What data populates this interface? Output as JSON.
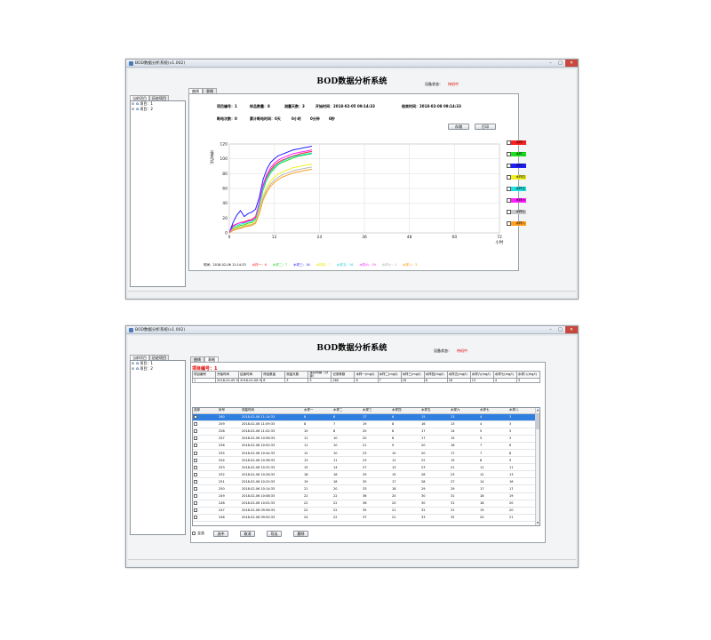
{
  "window_title": "BOD数据分析系统(v1.002)",
  "system_name": "BOD数据分析系统",
  "device_status_label": "设备状态：",
  "device_status_value": "待机中",
  "left_tabs": [
    "当前项目",
    "历史项目"
  ],
  "tree_items": [
    "项目：1",
    "项目：2"
  ],
  "main_tabs": [
    "曲线",
    "表格"
  ],
  "chart_info": {
    "project_no": "项目编号：1",
    "sample_count": "样品数量：8",
    "test_days": "测量天数：3",
    "start_time": "开始时间：2018-02-05 09:14:33",
    "end_time": "结束时间：2018-02-08 09:14:33",
    "power_off_count": "断电次数：0",
    "power_off_total": "累计断电时间：0天",
    "power_off_hours": "0小时",
    "power_off_minutes": "0分钟",
    "power_off_seconds": "0秒"
  },
  "buttons": {
    "save": "存储",
    "print": "打印"
  },
  "legend": [
    {
      "label": "水样一",
      "color": "#ff2020"
    },
    {
      "label": "水样二",
      "color": "#20e020"
    },
    {
      "label": "水样三",
      "color": "#2020ff"
    },
    {
      "label": "水样四",
      "color": "#f0f020"
    },
    {
      "label": "水样五",
      "color": "#20e0e0"
    },
    {
      "label": "水样六",
      "color": "#ff20ff"
    },
    {
      "label": "水样七",
      "color": "#c8c8c8"
    },
    {
      "label": "水样八",
      "color": "#ffa020"
    }
  ],
  "chart_footer": [
    {
      "text": "时间：2018-02-06 11:14:33",
      "color": "#000000"
    },
    {
      "text": "水样一：6",
      "color": "#ff2020"
    },
    {
      "text": "水样二：7",
      "color": "#20d020"
    },
    {
      "text": "水样三：16",
      "color": "#2020ff"
    },
    {
      "text": "水样四：7",
      "color": "#e8e800"
    },
    {
      "text": "水样五：16",
      "color": "#20d0d0"
    },
    {
      "text": "水样六：19",
      "color": "#ff20ff"
    },
    {
      "text": "水样七：4",
      "color": "#b0b0b0"
    },
    {
      "text": "水样八：3",
      "color": "#ff9000"
    }
  ],
  "chart_data": {
    "type": "line",
    "xlabel": "小时",
    "ylabel": "毫克/升",
    "xlim": [
      0,
      72
    ],
    "ylim": [
      0,
      120
    ],
    "xticks": [
      0,
      12,
      24,
      36,
      48,
      60,
      72
    ],
    "yticks": [
      0,
      20,
      40,
      60,
      80,
      100,
      120
    ],
    "grid": true,
    "x": [
      0,
      1,
      2,
      3,
      4,
      5,
      6,
      7,
      8,
      9,
      10,
      11,
      12,
      13,
      14,
      15,
      16,
      17,
      18,
      19,
      20,
      21,
      22
    ],
    "series": [
      {
        "name": "水样一",
        "color": "#ff2020",
        "values": [
          0,
          10,
          12,
          14,
          15,
          17,
          18,
          22,
          40,
          62,
          76,
          85,
          91,
          95,
          98,
          100,
          102,
          104,
          105,
          107,
          108,
          109,
          110
        ]
      },
      {
        "name": "水样二",
        "color": "#20e020",
        "values": [
          0,
          6,
          8,
          10,
          11,
          13,
          14,
          18,
          36,
          58,
          72,
          81,
          87,
          92,
          95,
          97,
          99,
          101,
          103,
          104,
          105,
          106,
          107
        ]
      },
      {
        "name": "水样三",
        "color": "#2020ff",
        "values": [
          0,
          14,
          24,
          30,
          22,
          26,
          28,
          32,
          48,
          72,
          86,
          95,
          100,
          104,
          106,
          108,
          110,
          112,
          113,
          114,
          115,
          116,
          117
        ]
      },
      {
        "name": "水样四",
        "color": "#f0f020",
        "values": [
          0,
          5,
          7,
          8,
          10,
          11,
          12,
          15,
          30,
          50,
          62,
          70,
          75,
          79,
          82,
          84,
          86,
          88,
          89,
          90,
          91,
          92,
          93
        ]
      },
      {
        "name": "水样五",
        "color": "#20e0e0",
        "values": [
          0,
          8,
          10,
          12,
          13,
          15,
          16,
          20,
          38,
          60,
          74,
          83,
          89,
          93,
          96,
          99,
          101,
          103,
          104,
          105,
          106,
          107,
          108
        ]
      },
      {
        "name": "水样六",
        "color": "#ff20ff",
        "values": [
          0,
          9,
          12,
          14,
          14,
          16,
          17,
          21,
          42,
          65,
          79,
          88,
          94,
          98,
          101,
          103,
          105,
          107,
          108,
          109,
          110,
          111,
          112
        ]
      },
      {
        "name": "水样七",
        "color": "#b8b8b8",
        "values": [
          0,
          4,
          6,
          7,
          9,
          10,
          11,
          14,
          28,
          47,
          58,
          66,
          71,
          75,
          78,
          80,
          82,
          84,
          85,
          86,
          87,
          88,
          89
        ]
      },
      {
        "name": "水样八",
        "color": "#ffa020",
        "values": [
          0,
          3,
          5,
          6,
          8,
          9,
          10,
          13,
          26,
          44,
          55,
          63,
          68,
          72,
          75,
          77,
          79,
          81,
          82,
          83,
          84,
          85,
          86
        ]
      }
    ]
  },
  "table_view": {
    "project_label": "项目编号：1",
    "summary_headers": [
      "项目编号",
      "开始时间",
      "结束时间",
      "样品数量",
      "测量天数",
      "保存间隔（分钟）",
      "记录条数",
      "水样一(mg/l)",
      "水样二(mg/l)",
      "水样三(mg/l)",
      "水样四(mg/l)",
      "水样五(mg/l)",
      "水样六(mg/l)",
      "水样七(mg/l)",
      "水样八(mg/l)"
    ],
    "summary_values": [
      "1",
      "2018-02-05 9:14",
      "2018-02-08 9:14",
      "8",
      "3",
      "5",
      "260",
      "6",
      "7",
      "16",
      "6",
      "16",
      "13",
      "4",
      "3"
    ],
    "grid_headers": [
      "选择",
      "序号",
      "测量时间",
      "水样一",
      "水样二",
      "水样三",
      "水样四",
      "水样五",
      "水样六",
      "水样七",
      "水样八"
    ],
    "rows": [
      [
        "260",
        "2018-02-06 11:14:33",
        "6",
        "6",
        "17",
        "6",
        "15",
        "13",
        "4",
        "3"
      ],
      [
        "259",
        "2018-02-06 11:09:33",
        "8",
        "7",
        "19",
        "8",
        "16",
        "13",
        "4",
        "3"
      ],
      [
        "258",
        "2018-02-06 11:02:33",
        "10",
        "8",
        "20",
        "8",
        "17",
        "14",
        "5",
        "3"
      ],
      [
        "257",
        "2018-02-06 10:56:33",
        "11",
        "10",
        "20",
        "8",
        "17",
        "15",
        "5",
        "3"
      ],
      [
        "256",
        "2018-02-06 10:50:33",
        "11",
        "10",
        "21",
        "9",
        "20",
        "16",
        "7",
        "6"
      ],
      [
        "255",
        "2018-02-06 10:44:33",
        "12",
        "10",
        "23",
        "10",
        "20",
        "17",
        "7",
        "8"
      ],
      [
        "254",
        "2018-02-06 10:38:33",
        "13",
        "11",
        "23",
        "11",
        "22",
        "19",
        "8",
        "9"
      ],
      [
        "253",
        "2018-02-06 10:32:33",
        "15",
        "14",
        "27",
        "13",
        "23",
        "21",
        "11",
        "11"
      ],
      [
        "252",
        "2018-02-06 10:26:33",
        "18",
        "16",
        "29",
        "15",
        "26",
        "23",
        "12",
        "13"
      ],
      [
        "251",
        "2018-02-06 10:20:33",
        "19",
        "18",
        "30",
        "17",
        "28",
        "27",
        "14",
        "16"
      ],
      [
        "250",
        "2018-02-06 10:14:33",
        "21",
        "20",
        "33",
        "18",
        "29",
        "29",
        "17",
        "17"
      ],
      [
        "249",
        "2018-02-06 10:08:33",
        "22",
        "22",
        "36",
        "20",
        "30",
        "31",
        "18",
        "19"
      ],
      [
        "248",
        "2018-02-06 10:02:33",
        "22",
        "22",
        "36",
        "20",
        "30",
        "31",
        "18",
        "20"
      ],
      [
        "247",
        "2018-02-06 09:56:33",
        "22",
        "22",
        "35",
        "21",
        "32",
        "31",
        "19",
        "20"
      ],
      [
        "246",
        "2018-02-06 09:50:33",
        "24",
        "22",
        "37",
        "21",
        "33",
        "32",
        "20",
        "21"
      ]
    ],
    "select_all_label": "全选",
    "buttons": [
      "选中",
      "取消",
      "导出",
      "删除"
    ]
  }
}
